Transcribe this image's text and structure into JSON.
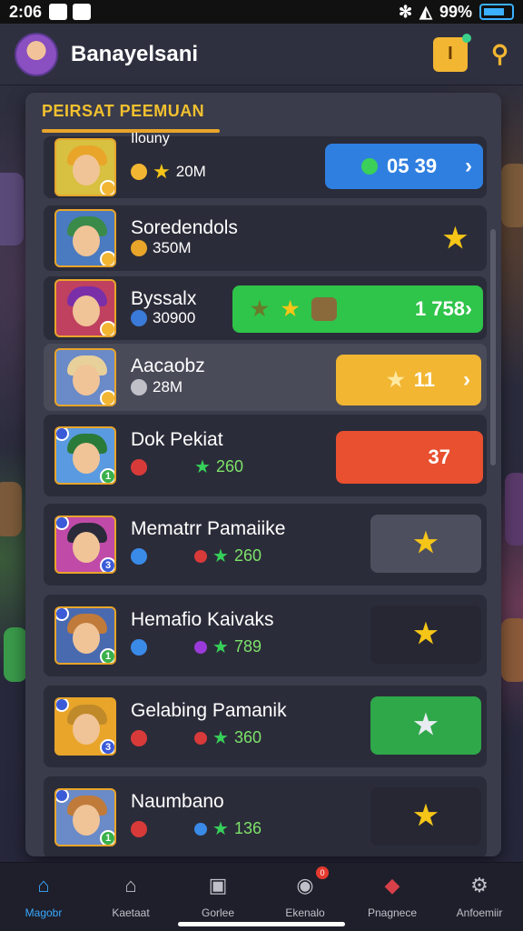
{
  "status": {
    "time": "2:06",
    "battery": "99%"
  },
  "header": {
    "title": "Banayelsani",
    "gift_glyph": "I",
    "search_glyph": "⚲"
  },
  "panel": {
    "title": "PEIRSAT PEEMUAN"
  },
  "rows": [
    {
      "name": "Ilouny",
      "stat": "20M",
      "action": "05 39",
      "action_color": "#2f7fe0",
      "hair": "#e8a52a",
      "bg": "#d8c040"
    },
    {
      "name": "Soredendols",
      "stat": "350M",
      "action": "",
      "hair": "#3a8a4a",
      "bg": "#4a7ac0"
    },
    {
      "name": "Byssalx",
      "stat": "30900",
      "action": "1 758",
      "action_color": "#2fc44a",
      "hair": "#7a2fa8",
      "bg": "#c04060"
    },
    {
      "name": "Aacaobz",
      "stat": "28M",
      "action": "11",
      "action_color": "#f2b632",
      "hair": "#e8d09a",
      "bg": "#6a8ac8"
    },
    {
      "name": "Dok Pekiat",
      "stat": "260",
      "action": "37",
      "action_color": "#e8502f",
      "hair": "#2a7a3a",
      "bg": "#5a9ae0",
      "lvl": "1"
    },
    {
      "name": "Mematrr Pamaiike",
      "stat": "260",
      "action": "",
      "hair": "#2a2a3a",
      "bg": "#c04aa8",
      "lvl": "3"
    },
    {
      "name": "Hemafio Kaivaks",
      "stat": "789",
      "action": "",
      "hair": "#c07a3a",
      "bg": "#4a6ab0",
      "lvl": "1"
    },
    {
      "name": "Gelabing Pamanik",
      "stat": "360",
      "action": "",
      "hair": "#c08a2a",
      "bg": "#e8a52a",
      "lvl": "3"
    },
    {
      "name": "Naumbano",
      "stat": "136",
      "action": "",
      "hair": "#c07a3a",
      "bg": "#6a8ac8",
      "lvl": "1"
    }
  ],
  "nav": [
    {
      "label": "Magobr",
      "active": true
    },
    {
      "label": "Kaetaat"
    },
    {
      "label": "Gorlee"
    },
    {
      "label": "Ekenalo",
      "badge": "0"
    },
    {
      "label": "Pnagnece"
    },
    {
      "label": "Anfoemiir"
    }
  ],
  "colors": {
    "accent": "#f2c12f",
    "active_nav": "#3aa8ff"
  }
}
